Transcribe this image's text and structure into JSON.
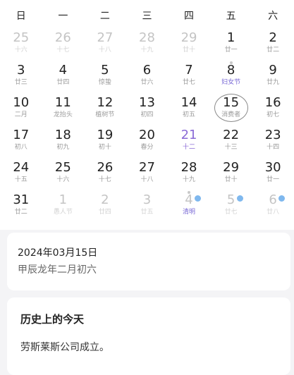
{
  "weekdays": [
    "日",
    "一",
    "二",
    "三",
    "四",
    "五",
    "六"
  ],
  "days": [
    {
      "num": "25",
      "lunar": "十六",
      "muted": true
    },
    {
      "num": "26",
      "lunar": "十七",
      "muted": true
    },
    {
      "num": "27",
      "lunar": "十八",
      "muted": true
    },
    {
      "num": "28",
      "lunar": "十九",
      "muted": true
    },
    {
      "num": "29",
      "lunar": "廿十",
      "muted": true
    },
    {
      "num": "1",
      "lunar": "廿一"
    },
    {
      "num": "2",
      "lunar": "廿二"
    },
    {
      "num": "3",
      "lunar": "廿三"
    },
    {
      "num": "4",
      "lunar": "廿四"
    },
    {
      "num": "5",
      "lunar": "惊蛰"
    },
    {
      "num": "6",
      "lunar": "廿六"
    },
    {
      "num": "7",
      "lunar": "廿七"
    },
    {
      "num": "8",
      "lunar": "妇女节",
      "festival": true,
      "dot_top": true
    },
    {
      "num": "9",
      "lunar": "廿九"
    },
    {
      "num": "10",
      "lunar": "二月"
    },
    {
      "num": "11",
      "lunar": "龙抬头"
    },
    {
      "num": "12",
      "lunar": "植树节"
    },
    {
      "num": "13",
      "lunar": "初四"
    },
    {
      "num": "14",
      "lunar": "初五"
    },
    {
      "num": "15",
      "lunar": "消费者",
      "selected": true
    },
    {
      "num": "16",
      "lunar": "初七"
    },
    {
      "num": "17",
      "lunar": "初八"
    },
    {
      "num": "18",
      "lunar": "初九"
    },
    {
      "num": "19",
      "lunar": "初十"
    },
    {
      "num": "20",
      "lunar": "春分"
    },
    {
      "num": "21",
      "lunar": "十二",
      "today": true
    },
    {
      "num": "22",
      "lunar": "十三"
    },
    {
      "num": "23",
      "lunar": "十四"
    },
    {
      "num": "24",
      "lunar": "十五"
    },
    {
      "num": "25",
      "lunar": "十六"
    },
    {
      "num": "26",
      "lunar": "十七"
    },
    {
      "num": "27",
      "lunar": "十八"
    },
    {
      "num": "28",
      "lunar": "十九"
    },
    {
      "num": "29",
      "lunar": "廿十"
    },
    {
      "num": "30",
      "lunar": "廿一"
    },
    {
      "num": "31",
      "lunar": "廿二"
    },
    {
      "num": "1",
      "lunar": "愚人节",
      "muted": true
    },
    {
      "num": "2",
      "lunar": "廿四",
      "muted": true
    },
    {
      "num": "3",
      "lunar": "廿五",
      "muted": true
    },
    {
      "num": "4",
      "lunar": "清明",
      "muted": true,
      "festival": true,
      "dot_top": true,
      "dot_side": true
    },
    {
      "num": "5",
      "lunar": "廿七",
      "muted": true,
      "dot_side": true
    },
    {
      "num": "6",
      "lunar": "廿八",
      "muted": true,
      "dot_side": true
    }
  ],
  "info": {
    "date": "2024年03月15日",
    "lunar_date": "甲辰龙年二月初六"
  },
  "history": {
    "title": "历史上的今天",
    "item": "劳斯莱斯公司成立。"
  },
  "colors": {
    "today": "#8a6ad6",
    "event_dot": "#7fb8ee",
    "muted": "#c4c4c4"
  }
}
